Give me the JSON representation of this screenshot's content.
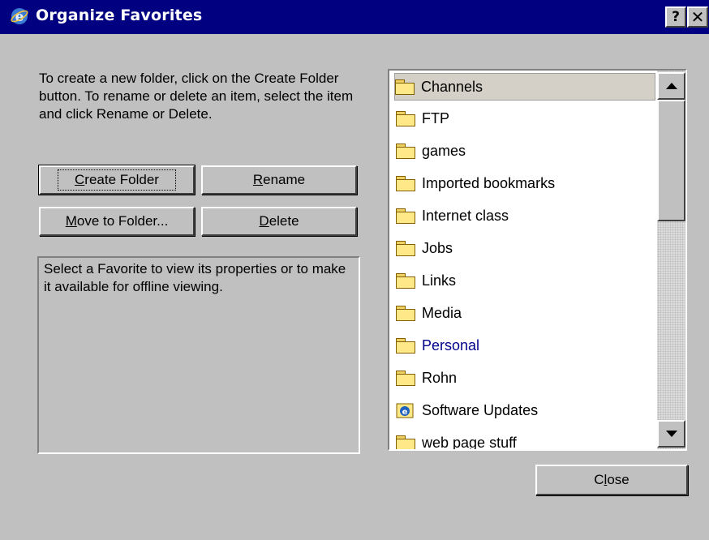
{
  "window": {
    "title": "Organize Favorites",
    "help_label": "?",
    "close_label": "✕"
  },
  "instructions": "To create a new folder, click on the Create Folder button. To rename or delete an item, select the item and click Rename or Delete.",
  "buttons": {
    "create_folder": {
      "prefix": "",
      "accel": "C",
      "rest": "reate Folder"
    },
    "rename": {
      "prefix": "",
      "accel": "R",
      "rest": "ename"
    },
    "move_to_folder": {
      "prefix": "",
      "accel": "M",
      "rest": "ove to Folder..."
    },
    "delete": {
      "prefix": "",
      "accel": "D",
      "rest": "elete"
    },
    "close": {
      "prefix": "C",
      "accel": "l",
      "rest": "ose"
    }
  },
  "properties_text": "Select a Favorite to view its properties or to make it available for offline viewing.",
  "favorites": {
    "items": [
      {
        "label": "Channels",
        "icon": "folder-icon"
      },
      {
        "label": "FTP",
        "icon": "folder-icon"
      },
      {
        "label": "games",
        "icon": "folder-icon"
      },
      {
        "label": "Imported bookmarks",
        "icon": "folder-icon"
      },
      {
        "label": "Internet class",
        "icon": "folder-icon"
      },
      {
        "label": "Jobs",
        "icon": "folder-icon"
      },
      {
        "label": "Links",
        "icon": "folder-icon"
      },
      {
        "label": "Media",
        "icon": "folder-icon"
      },
      {
        "label": "Personal",
        "icon": "folder-icon"
      },
      {
        "label": "Rohn",
        "icon": "folder-icon"
      },
      {
        "label": "Software Updates",
        "icon": "software-updates-icon"
      },
      {
        "label": "web page stuff",
        "icon": "folder-icon"
      }
    ],
    "selected_index": 0,
    "hot_index": 8
  },
  "colors": {
    "titlebar": "#000080",
    "window": "#c0c0c0",
    "hot_text": "#00008b"
  }
}
